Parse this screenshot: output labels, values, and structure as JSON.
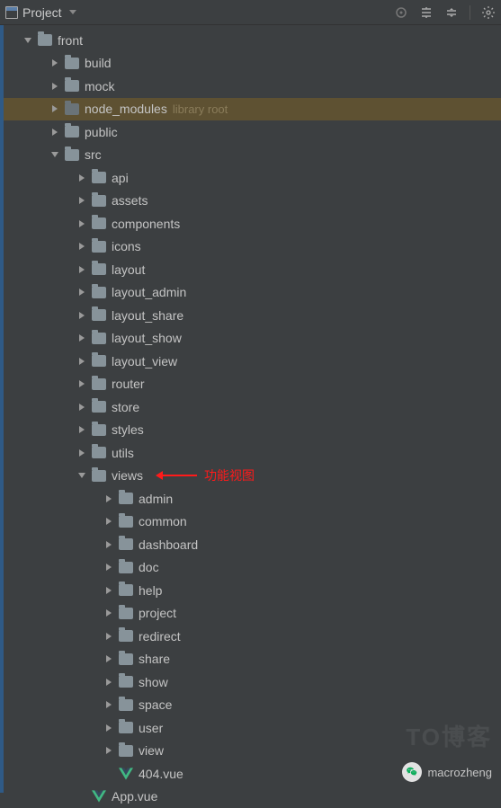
{
  "header": {
    "title": "Project"
  },
  "annotation": {
    "text": "功能视图"
  },
  "watermark": {
    "text": "macrozheng",
    "background_text": "TO博客"
  },
  "tree": [
    {
      "indent": 20,
      "arrow": "open",
      "icon": "folder",
      "label": "front"
    },
    {
      "indent": 50,
      "arrow": "closed",
      "icon": "folder",
      "label": "build"
    },
    {
      "indent": 50,
      "arrow": "closed",
      "icon": "folder",
      "label": "mock"
    },
    {
      "indent": 50,
      "arrow": "closed",
      "icon": "folder-dark",
      "label": "node_modules",
      "suffix": "library root",
      "highlight": true
    },
    {
      "indent": 50,
      "arrow": "closed",
      "icon": "folder",
      "label": "public"
    },
    {
      "indent": 50,
      "arrow": "open",
      "icon": "folder",
      "label": "src"
    },
    {
      "indent": 80,
      "arrow": "closed",
      "icon": "folder",
      "label": "api"
    },
    {
      "indent": 80,
      "arrow": "closed",
      "icon": "folder",
      "label": "assets"
    },
    {
      "indent": 80,
      "arrow": "closed",
      "icon": "folder",
      "label": "components"
    },
    {
      "indent": 80,
      "arrow": "closed",
      "icon": "folder",
      "label": "icons"
    },
    {
      "indent": 80,
      "arrow": "closed",
      "icon": "folder",
      "label": "layout"
    },
    {
      "indent": 80,
      "arrow": "closed",
      "icon": "folder",
      "label": "layout_admin"
    },
    {
      "indent": 80,
      "arrow": "closed",
      "icon": "folder",
      "label": "layout_share"
    },
    {
      "indent": 80,
      "arrow": "closed",
      "icon": "folder",
      "label": "layout_show"
    },
    {
      "indent": 80,
      "arrow": "closed",
      "icon": "folder",
      "label": "layout_view"
    },
    {
      "indent": 80,
      "arrow": "closed",
      "icon": "folder",
      "label": "router"
    },
    {
      "indent": 80,
      "arrow": "closed",
      "icon": "folder",
      "label": "store"
    },
    {
      "indent": 80,
      "arrow": "closed",
      "icon": "folder",
      "label": "styles"
    },
    {
      "indent": 80,
      "arrow": "closed",
      "icon": "folder",
      "label": "utils"
    },
    {
      "indent": 80,
      "arrow": "open",
      "icon": "folder",
      "label": "views",
      "annotation": true
    },
    {
      "indent": 110,
      "arrow": "closed",
      "icon": "folder",
      "label": "admin"
    },
    {
      "indent": 110,
      "arrow": "closed",
      "icon": "folder",
      "label": "common"
    },
    {
      "indent": 110,
      "arrow": "closed",
      "icon": "folder",
      "label": "dashboard"
    },
    {
      "indent": 110,
      "arrow": "closed",
      "icon": "folder",
      "label": "doc"
    },
    {
      "indent": 110,
      "arrow": "closed",
      "icon": "folder",
      "label": "help"
    },
    {
      "indent": 110,
      "arrow": "closed",
      "icon": "folder",
      "label": "project"
    },
    {
      "indent": 110,
      "arrow": "closed",
      "icon": "folder",
      "label": "redirect"
    },
    {
      "indent": 110,
      "arrow": "closed",
      "icon": "folder",
      "label": "share"
    },
    {
      "indent": 110,
      "arrow": "closed",
      "icon": "folder",
      "label": "show"
    },
    {
      "indent": 110,
      "arrow": "closed",
      "icon": "folder",
      "label": "space"
    },
    {
      "indent": 110,
      "arrow": "closed",
      "icon": "folder",
      "label": "user"
    },
    {
      "indent": 110,
      "arrow": "closed",
      "icon": "folder",
      "label": "view"
    },
    {
      "indent": 110,
      "arrow": "none",
      "icon": "vue",
      "label": "404.vue"
    },
    {
      "indent": 80,
      "arrow": "none",
      "icon": "vue",
      "label": "App.vue"
    }
  ]
}
